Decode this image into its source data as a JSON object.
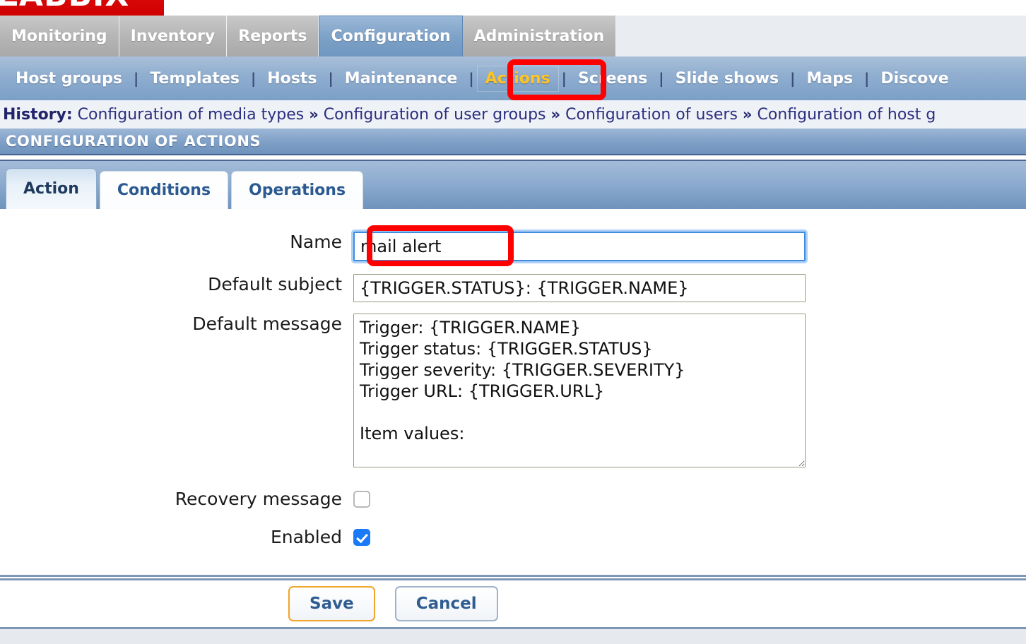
{
  "brand": {
    "logo_text": "ZABBIX",
    "logo_color": "#d40000"
  },
  "main_menu": {
    "items": [
      {
        "label": "Monitoring",
        "selected": false
      },
      {
        "label": "Inventory",
        "selected": false
      },
      {
        "label": "Reports",
        "selected": false
      },
      {
        "label": "Configuration",
        "selected": true
      },
      {
        "label": "Administration",
        "selected": false
      }
    ]
  },
  "sub_menu": {
    "selected_color": "#ffc424",
    "items": [
      {
        "label": "Host groups",
        "selected": false
      },
      {
        "label": "Templates",
        "selected": false
      },
      {
        "label": "Hosts",
        "selected": false
      },
      {
        "label": "Maintenance",
        "selected": false
      },
      {
        "label": "Actions",
        "selected": true
      },
      {
        "label": "Screens",
        "selected": false
      },
      {
        "label": "Slide shows",
        "selected": false
      },
      {
        "label": "Maps",
        "selected": false
      },
      {
        "label": "Discove",
        "selected": false
      }
    ],
    "separator": "|"
  },
  "history": {
    "label": "History:",
    "separator": "»",
    "items": [
      "Configuration of media types",
      "Configuration of user groups",
      "Configuration of users",
      "Configuration of host g"
    ]
  },
  "page_title": "CONFIGURATION OF ACTIONS",
  "tabs": [
    {
      "label": "Action",
      "selected": true
    },
    {
      "label": "Conditions",
      "selected": false
    },
    {
      "label": "Operations",
      "selected": false
    }
  ],
  "form": {
    "name": {
      "label": "Name",
      "value": "mail alert",
      "placeholder": "",
      "focused": true
    },
    "default_subject": {
      "label": "Default subject",
      "value": "{TRIGGER.STATUS}: {TRIGGER.NAME}",
      "placeholder": ""
    },
    "default_message": {
      "label": "Default message",
      "value": "Trigger: {TRIGGER.NAME}\nTrigger status: {TRIGGER.STATUS}\nTrigger severity: {TRIGGER.SEVERITY}\nTrigger URL: {TRIGGER.URL}\n\nItem values:\n",
      "placeholder": ""
    },
    "recovery_message": {
      "label": "Recovery message",
      "checked": false
    },
    "enabled": {
      "label": "Enabled",
      "checked": true
    }
  },
  "footer": {
    "save_label": "Save",
    "cancel_label": "Cancel"
  },
  "annotations": [
    {
      "name": "actions-menu-highlight",
      "color": "#ff0000"
    },
    {
      "name": "name-field-highlight",
      "color": "#ff0000"
    }
  ]
}
